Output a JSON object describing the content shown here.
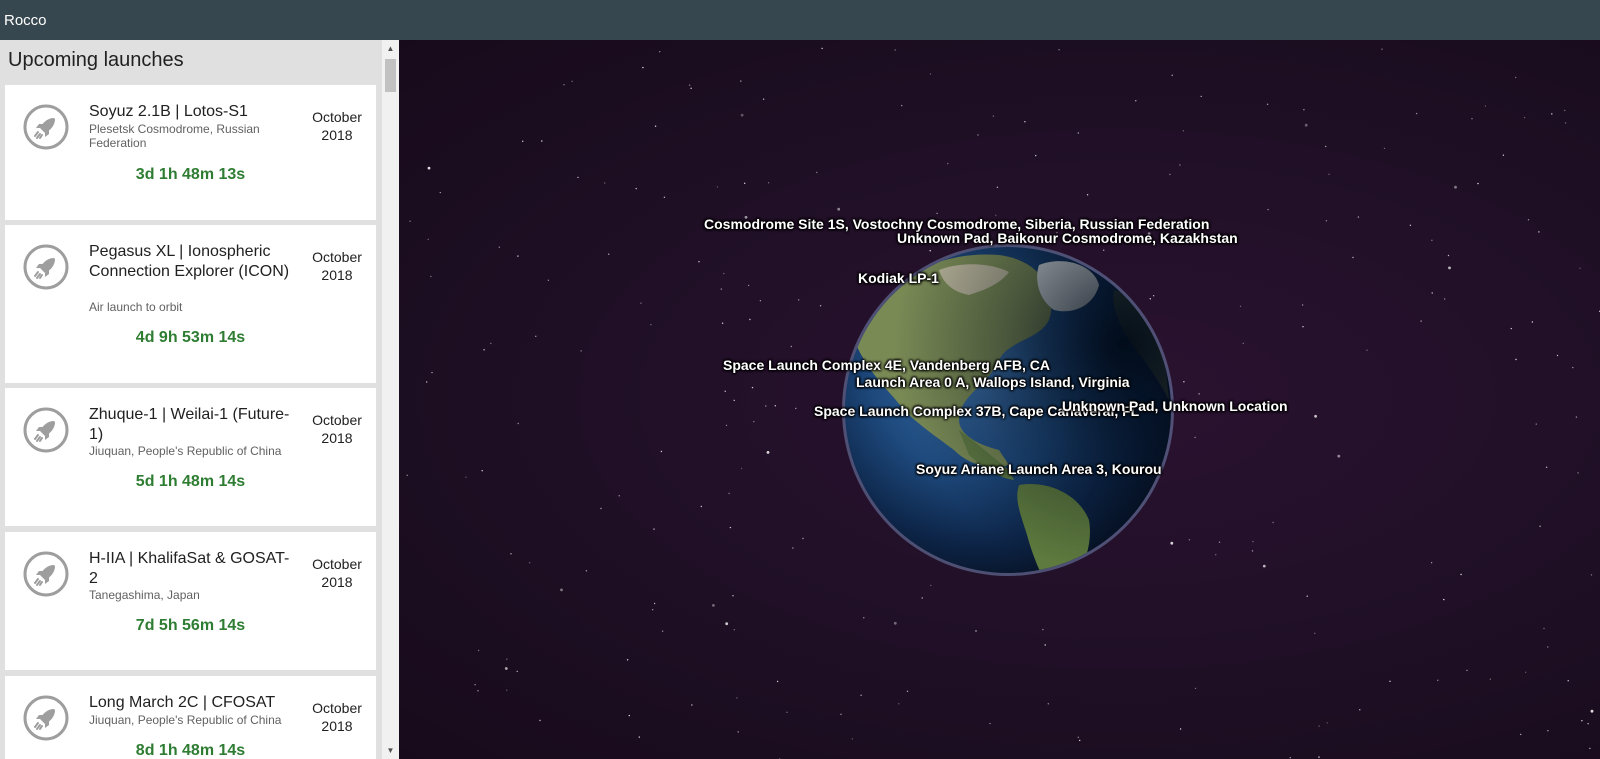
{
  "app": {
    "title": "Rocco"
  },
  "sidebar": {
    "heading": "Upcoming launches",
    "launches": [
      {
        "title": "Soyuz 2.1B | Lotos-S1",
        "location": "Plesetsk Cosmodrome, Russian Federation",
        "month": "October",
        "year": "2018",
        "countdown": "3d 1h 48m 13s"
      },
      {
        "title": "Pegasus XL | Ionospheric Connection Explorer (ICON)",
        "location": "Air launch to orbit",
        "month": "October",
        "year": "2018",
        "countdown": "4d 9h 53m 14s"
      },
      {
        "title": "Zhuque-1 | Weilai-1 (Future-1)",
        "location": "Jiuquan, People's Republic of China",
        "month": "October",
        "year": "2018",
        "countdown": "5d 1h 48m 14s"
      },
      {
        "title": "H-IIA | KhalifaSat & GOSAT-2",
        "location": "Tanegashima, Japan",
        "month": "October",
        "year": "2018",
        "countdown": "7d 5h 56m 14s"
      },
      {
        "title": "Long March 2C | CFOSAT",
        "location": "Jiuquan, People's Republic of China",
        "month": "October",
        "year": "2018",
        "countdown": "8d 1h 48m 14s"
      }
    ]
  },
  "globe": {
    "pins": [
      "Cosmodrome Site 1S, Vostochny Cosmodrome, Siberia, Russian Federation",
      "Unknown Pad, Baikonur Cosmodrome, Kazakhstan",
      "Kodiak LP-1",
      "Space Launch Complex 4E, Vandenberg AFB, CA",
      "Launch Area 0 A, Wallops Island, Virginia",
      "Space Launch Complex 37B, Cape Canaveral, FL",
      "Unknown Pad, Unknown Location",
      "Soyuz Ariane Launch Area 3, Kourou"
    ]
  },
  "colors": {
    "topbar": "#37474f",
    "countdown": "#2e7d32",
    "space": "#1f0f25"
  }
}
